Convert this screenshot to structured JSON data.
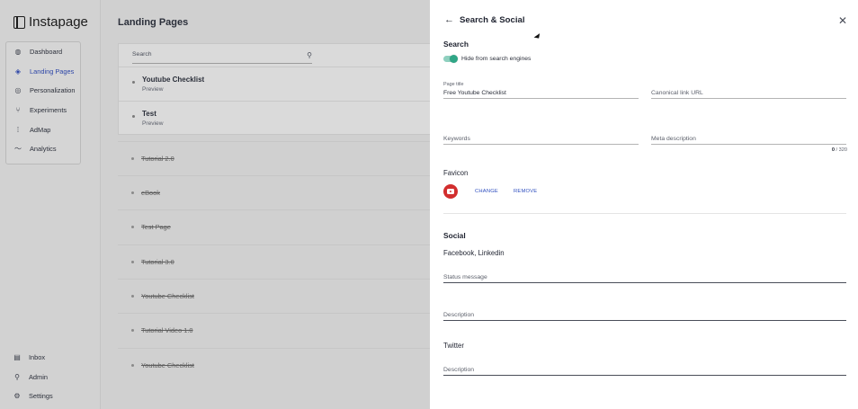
{
  "app": {
    "name": "Instapage"
  },
  "sidebar": {
    "items": [
      {
        "label": "Dashboard",
        "icon": "globe-icon",
        "active": false
      },
      {
        "label": "Landing Pages",
        "icon": "layers-icon",
        "active": true
      },
      {
        "label": "Personalization",
        "icon": "target-icon",
        "active": false
      },
      {
        "label": "Experiments",
        "icon": "branch-icon",
        "active": false
      },
      {
        "label": "AdMap",
        "icon": "admap-icon",
        "active": false
      },
      {
        "label": "Analytics",
        "icon": "trend-icon",
        "active": false
      }
    ],
    "bottom_items": [
      {
        "label": "Inbox",
        "icon": "inbox-icon"
      },
      {
        "label": "Admin",
        "icon": "user-icon"
      },
      {
        "label": "Settings",
        "icon": "gear-icon"
      }
    ]
  },
  "main": {
    "title": "Landing Pages",
    "search_placeholder": "Search",
    "pages": [
      {
        "name": "Youtube Checklist",
        "sub": "Preview"
      },
      {
        "name": "Test",
        "sub": "Preview"
      }
    ],
    "archived": [
      "Tutorial 2.0",
      "eBook",
      "Test Page",
      "Tutorial 3.0",
      "Youtube Checklist",
      "Tutorial Video 1.0",
      "Youtube Checklist"
    ]
  },
  "drawer": {
    "title": "Search & Social",
    "search": {
      "heading": "Search",
      "hide_label": "Hide from search engines",
      "hide_enabled": true,
      "page_title_label": "Page title",
      "page_title_value": "Free Youtube Checklist",
      "canonical_placeholder": "Canonical link URL",
      "keywords_placeholder": "Keywords",
      "meta_placeholder": "Meta description",
      "meta_count": "0",
      "meta_max": "/ 320"
    },
    "favicon": {
      "heading": "Favicon",
      "change_label": "CHANGE",
      "remove_label": "REMOVE"
    },
    "social": {
      "heading": "Social",
      "fb_heading": "Facebook, Linkedin",
      "status_placeholder": "Status message",
      "fb_description_placeholder": "Description",
      "twitter_heading": "Twitter",
      "tw_description_placeholder": "Description"
    }
  },
  "colors": {
    "accent": "#2f4fbf",
    "toggle_on": "#2fa686",
    "favicon": "#d22e2e"
  }
}
